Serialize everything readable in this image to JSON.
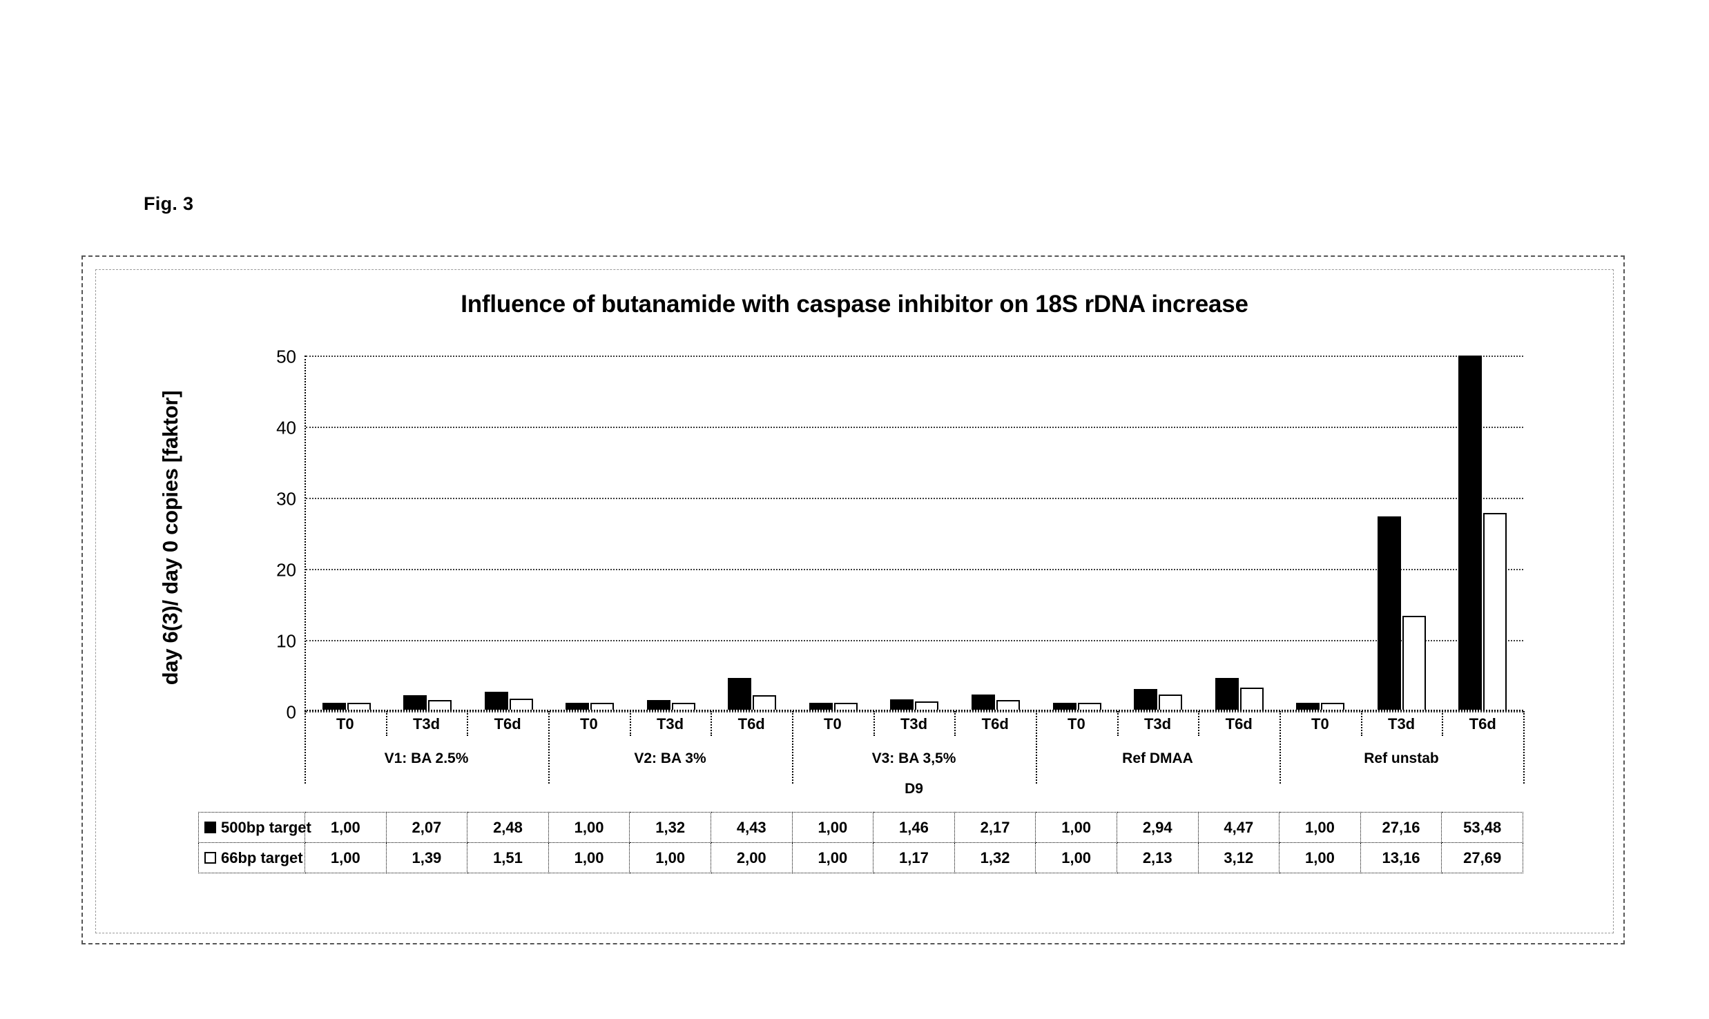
{
  "figure": {
    "label": "Fig. 3"
  },
  "chart_data": {
    "type": "bar",
    "title": "Influence of butanamide with caspase inhibitor on 18S rDNA increase",
    "xlabel": "D9",
    "ylabel": "day 6(3)/ day 0 copies [faktor]",
    "ylim": [
      0,
      50
    ],
    "yticks": [
      0,
      10,
      20,
      30,
      40,
      50
    ],
    "grid": true,
    "legend_position": "table-below",
    "categories": [
      "T0",
      "T3d",
      "T6d",
      "T0",
      "T3d",
      "T6d",
      "T0",
      "T3d",
      "T6d",
      "T0",
      "T3d",
      "T6d",
      "T0",
      "T3d",
      "T6d"
    ],
    "groups": [
      {
        "label": "V1: BA 2.5%",
        "span": 3
      },
      {
        "label": "V2: BA 3%",
        "span": 3
      },
      {
        "label": "V3: BA 3,5%",
        "span": 3
      },
      {
        "label": "Ref DMAA",
        "span": 3
      },
      {
        "label": "Ref unstab",
        "span": 3
      }
    ],
    "series": [
      {
        "name": "500bp target",
        "style": "filled",
        "color": "#000000",
        "values": [
          1.0,
          2.07,
          2.48,
          1.0,
          1.32,
          4.43,
          1.0,
          1.46,
          2.17,
          1.0,
          2.94,
          4.47,
          1.0,
          27.16,
          53.48
        ],
        "labels": [
          "1,00",
          "2,07",
          "2,48",
          "1,00",
          "1,32",
          "4,43",
          "1,00",
          "1,46",
          "2,17",
          "1,00",
          "2,94",
          "4,47",
          "1,00",
          "27,16",
          "53,48"
        ]
      },
      {
        "name": "66bp target",
        "style": "hollow",
        "color": "#ffffff",
        "values": [
          1.0,
          1.39,
          1.51,
          1.0,
          1.0,
          2.0,
          1.0,
          1.17,
          1.32,
          1.0,
          2.13,
          3.12,
          1.0,
          13.16,
          27.69
        ],
        "labels": [
          "1,00",
          "1,39",
          "1,51",
          "1,00",
          "1,00",
          "2,00",
          "1,00",
          "1,17",
          "1,32",
          "1,00",
          "2,13",
          "3,12",
          "1,00",
          "13,16",
          "27,69"
        ]
      }
    ]
  }
}
